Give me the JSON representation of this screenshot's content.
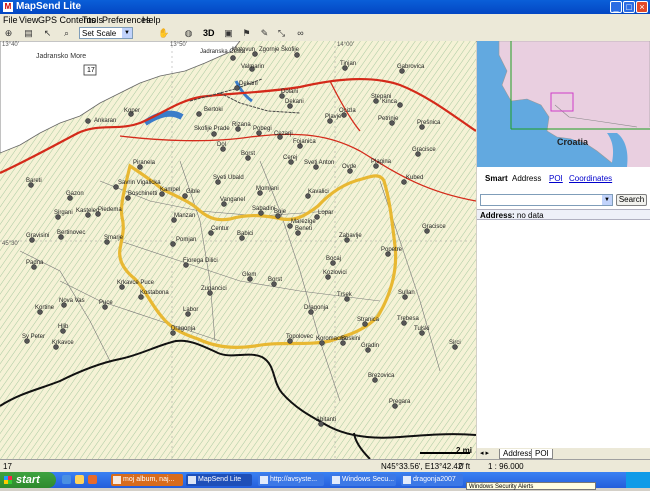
{
  "window": {
    "title": "MapSend Lite",
    "controls": {
      "minimize": "_",
      "maximize": "□",
      "close": "×"
    }
  },
  "menu": [
    "File",
    "View",
    "GPS Contents",
    "Tools",
    "Preferences",
    "Help"
  ],
  "toolbar": {
    "scale_label": "Set Scale",
    "view_3d": "3D"
  },
  "map": {
    "highway_shield": "17",
    "scale_text": "2 mi",
    "sea_label": "Jadransko More",
    "grid_labels": [
      "13°40'",
      "13°50'",
      "14°00'",
      "45°30'"
    ],
    "towns": [
      {
        "name": "Jadranska Cesta"
      },
      {
        "name": "Motovun"
      },
      {
        "name": "Zgornje Škofije"
      },
      {
        "name": "Tinjan"
      },
      {
        "name": "Valmarin"
      },
      {
        "name": "Gabrovica"
      },
      {
        "name": "Dekani"
      },
      {
        "name": "Bertoki"
      },
      {
        "name": "Koper"
      },
      {
        "name": "Dekani"
      },
      {
        "name": "Dolani"
      },
      {
        "name": "Ankaran"
      },
      {
        "name": "Skofije Prade"
      },
      {
        "name": "Pobegi"
      },
      {
        "name": "Cezarji"
      },
      {
        "name": "Rizana"
      },
      {
        "name": "Plavje"
      },
      {
        "name": "Stepani"
      },
      {
        "name": "Kinca"
      },
      {
        "name": "Prešnica"
      },
      {
        "name": "Ocizla"
      },
      {
        "name": "Petrinje"
      },
      {
        "name": "Dol"
      },
      {
        "name": "Borst"
      },
      {
        "name": "Cerej"
      },
      {
        "name": "Sveti Anton"
      },
      {
        "name": "Fojanica"
      },
      {
        "name": "Gracisce"
      },
      {
        "name": "Plagina"
      },
      {
        "name": "Piranela"
      },
      {
        "name": "Bareti"
      },
      {
        "name": "Gazon"
      },
      {
        "name": "Sveti Ubald"
      },
      {
        "name": "Momjani"
      },
      {
        "name": "Ovde"
      },
      {
        "name": "Kubed"
      },
      {
        "name": "Savrin Vigalicka"
      },
      {
        "name": "Boschinetti"
      },
      {
        "name": "Kampel"
      },
      {
        "name": "Gible"
      },
      {
        "name": "Vanganel"
      },
      {
        "name": "Kavalici"
      },
      {
        "name": "Sirgani"
      },
      {
        "name": "Kastelec"
      },
      {
        "name": "Piedema"
      },
      {
        "name": "Sabadini"
      },
      {
        "name": "Buje"
      },
      {
        "name": "Lopar"
      },
      {
        "name": "Marezige"
      },
      {
        "name": "Manzan"
      },
      {
        "name": "Centur"
      },
      {
        "name": "Babici"
      },
      {
        "name": "Beneti"
      },
      {
        "name": "Zabavlje"
      },
      {
        "name": "Gracisce"
      },
      {
        "name": "Gravisini"
      },
      {
        "name": "Bertinovec"
      },
      {
        "name": "Smarje"
      },
      {
        "name": "Pomjan"
      },
      {
        "name": "Popetre"
      },
      {
        "name": "Padna"
      },
      {
        "name": "Fiorega Dilici"
      },
      {
        "name": "Bocaj"
      },
      {
        "name": "Kozlovici"
      },
      {
        "name": "Glem"
      },
      {
        "name": "Borst"
      },
      {
        "name": "Krkavce Puce"
      },
      {
        "name": "Kostabona"
      },
      {
        "name": "Zupancici"
      },
      {
        "name": "Trsek"
      },
      {
        "name": "Sullan"
      },
      {
        "name": "Nova Vas"
      },
      {
        "name": "Puce"
      },
      {
        "name": "Dragonja"
      },
      {
        "name": "Labor"
      },
      {
        "name": "Stranica"
      },
      {
        "name": "Trebesa"
      },
      {
        "name": "Kortine"
      },
      {
        "name": "Tulski"
      },
      {
        "name": "Hlib"
      },
      {
        "name": "Sv Peter"
      },
      {
        "name": "Krkavce"
      },
      {
        "name": "Dragonja"
      },
      {
        "name": "Topolovec"
      },
      {
        "name": "Koromacna"
      },
      {
        "name": "Boskini"
      },
      {
        "name": "Gradin"
      },
      {
        "name": "Sirci"
      },
      {
        "name": "Brezovica"
      },
      {
        "name": "Pregara"
      },
      {
        "name": "Abitanti"
      }
    ]
  },
  "overview": {
    "country_label": "Croatia"
  },
  "search": {
    "tabs": [
      "Smart",
      "Address",
      "POI",
      "Coordinates"
    ],
    "button": "Search",
    "result_label": "Address:",
    "result_value": "no data",
    "bottom_tabs": [
      "Address",
      "POI"
    ]
  },
  "status": {
    "left": "17",
    "coords": "N45°33.56', E13°42.42'",
    "elevation": "0 ft",
    "scale": "1 : 96.000"
  },
  "taskbar": {
    "start": "start",
    "buttons": [
      "moj album, naj...",
      "MapSend Lite",
      "http://avsyste...",
      "Windows Secu...",
      "dragonja2007"
    ],
    "balloon": "Windows Security Alerts"
  },
  "colors": {
    "map_bg": "#f5f2d6",
    "sea": "#62a9e0",
    "route": "#e8b832",
    "road": "#d42a1a",
    "border": "#111111"
  }
}
